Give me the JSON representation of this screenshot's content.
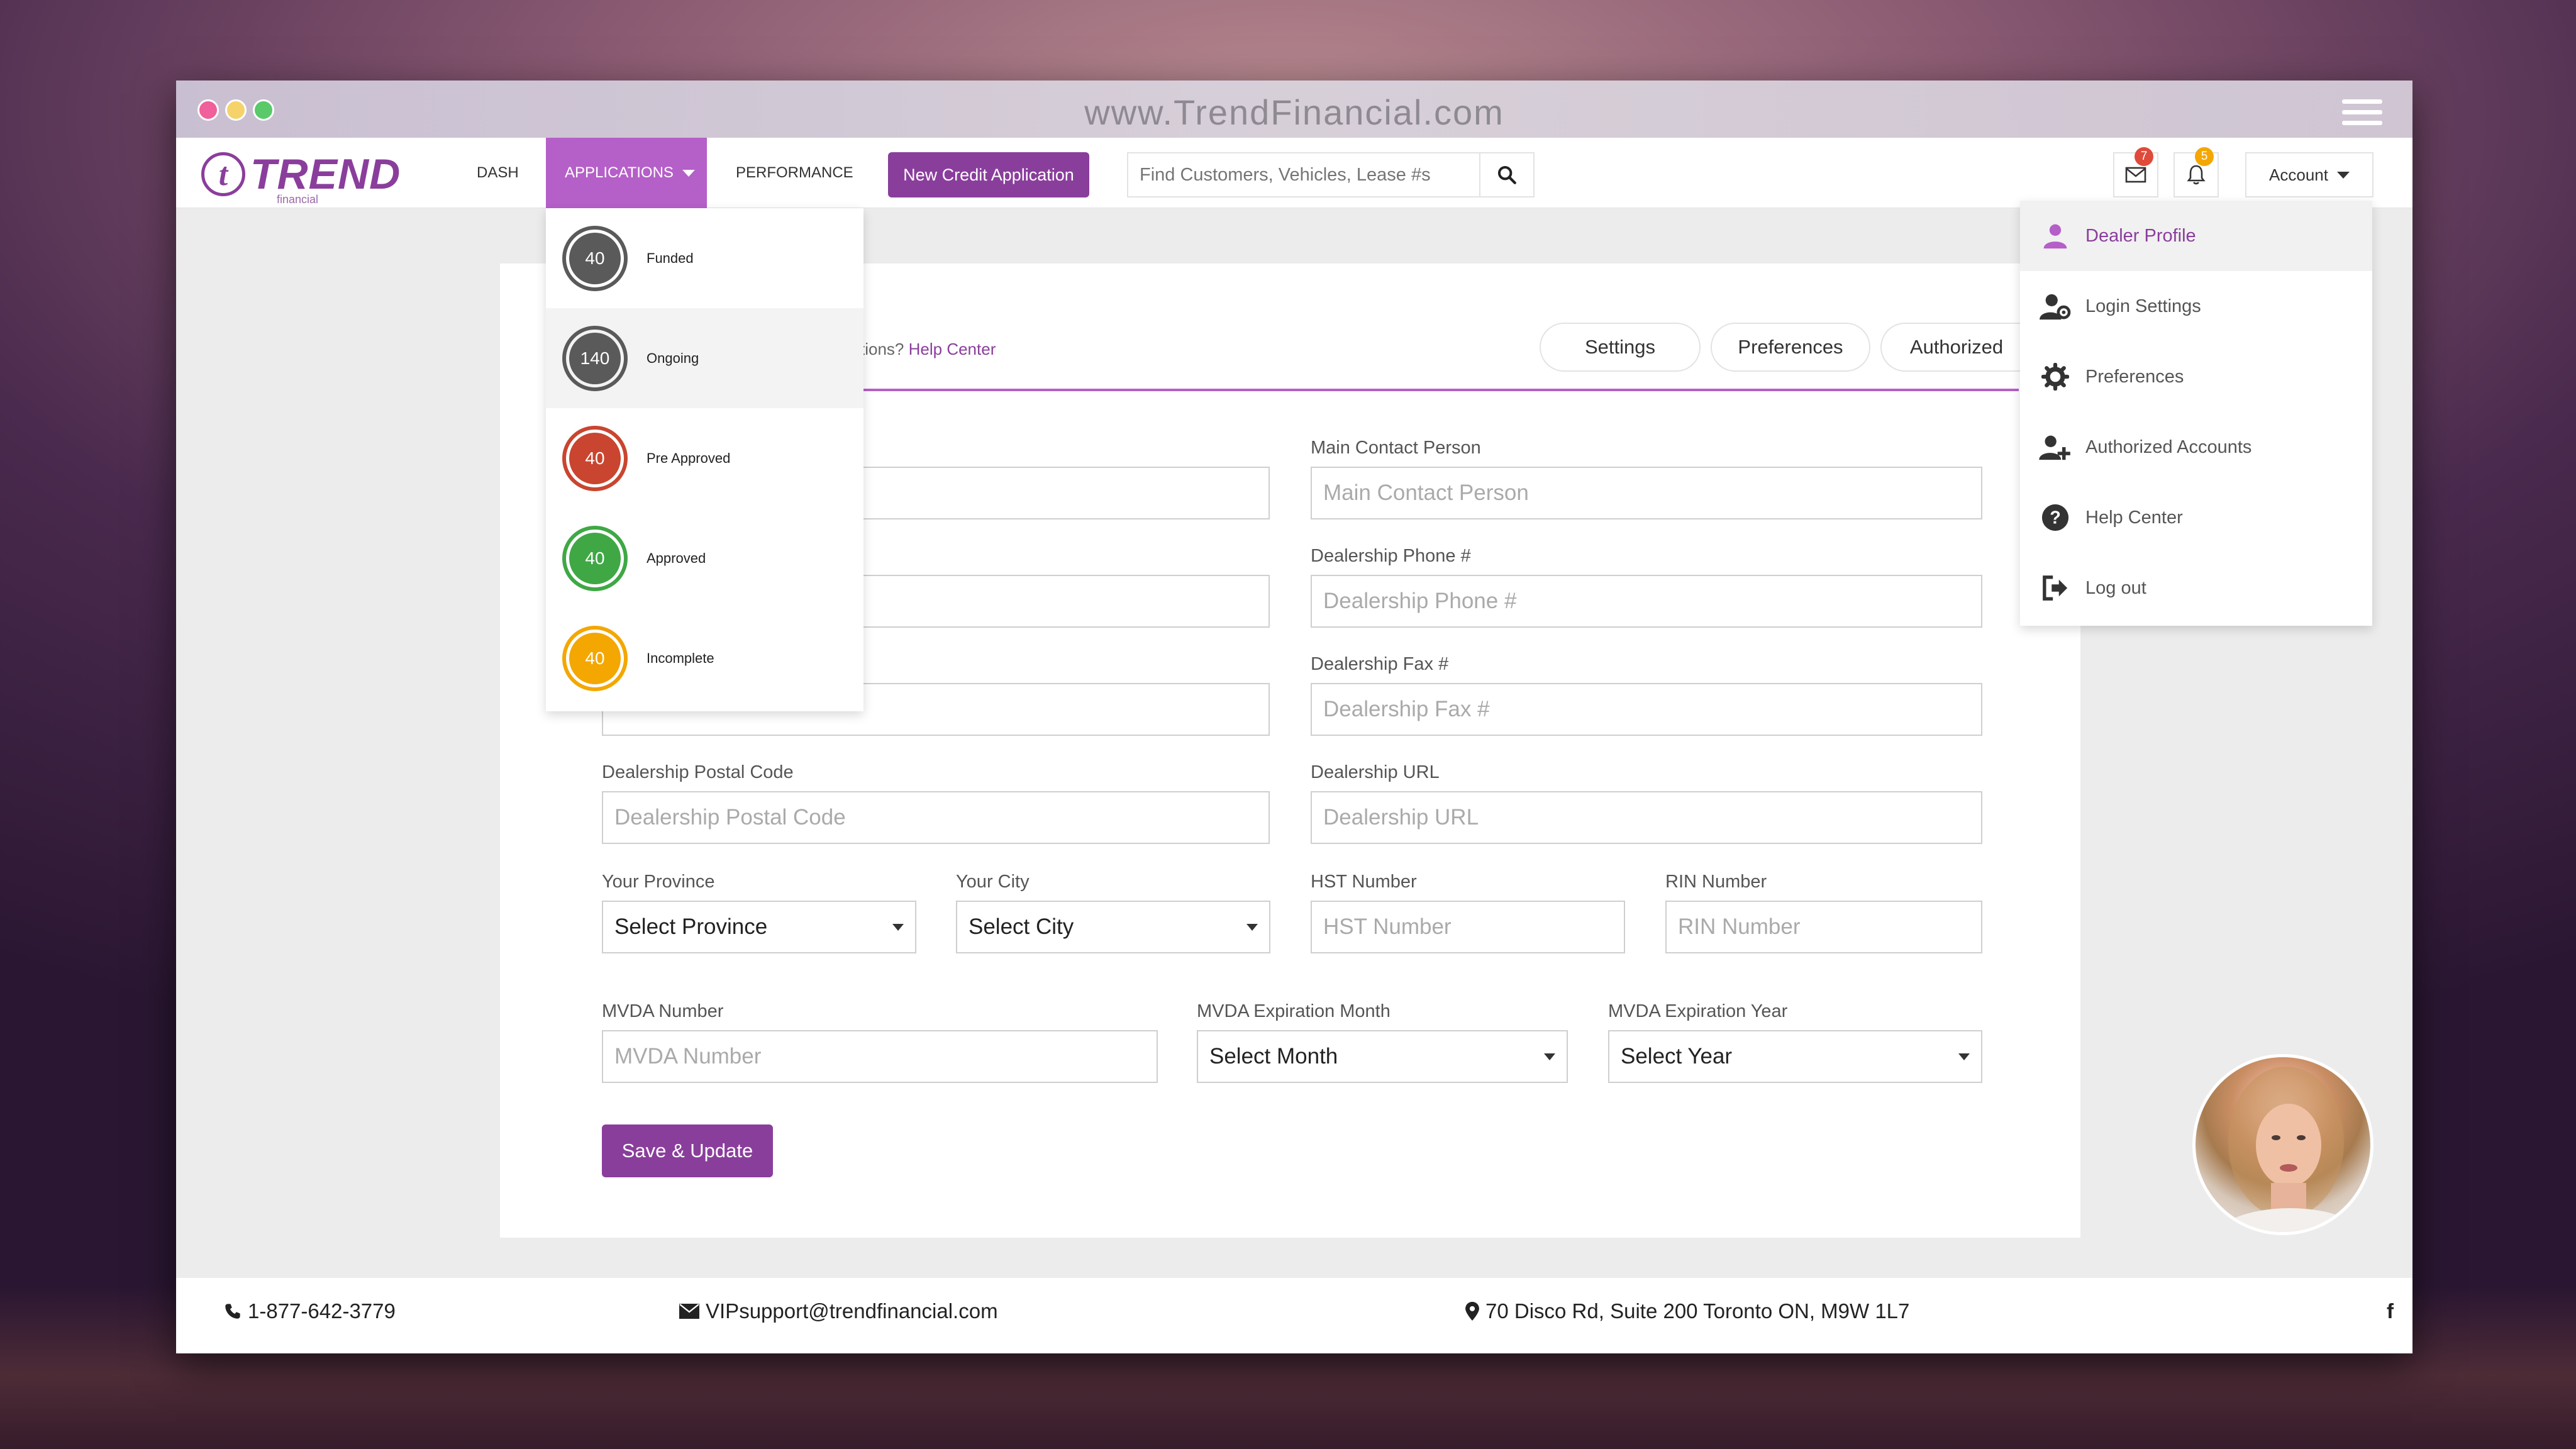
{
  "window": {
    "url": "www.TrendFinancial.com"
  },
  "brand": {
    "name": "TREND",
    "sub": "financial",
    "color": "#8a3e9c"
  },
  "nav": {
    "dash": "DASH",
    "applications": "APPLICATIONS",
    "performance": "PERFORMANCE",
    "new_credit": "New Credit Application",
    "search_placeholder": "Find Customers, Vehicles, Lease #s",
    "mail_count": "7",
    "notif_count": "5",
    "account": "Account"
  },
  "applications_menu": [
    {
      "count": "40",
      "label": "Funded",
      "color": "#5a5a5a"
    },
    {
      "count": "140",
      "label": "Ongoing",
      "color": "#5a5a5a"
    },
    {
      "count": "40",
      "label": "Pre Approved",
      "color": "#c9452f"
    },
    {
      "count": "40",
      "label": "Approved",
      "color": "#3fa845"
    },
    {
      "count": "40",
      "label": "Incomplete",
      "color": "#f3a700"
    }
  ],
  "account_menu": [
    {
      "label": "Dealer Profile",
      "icon": "user-icon"
    },
    {
      "label": "Login Settings",
      "icon": "user-settings-icon"
    },
    {
      "label": "Preferences",
      "icon": "gear-icon"
    },
    {
      "label": "Authorized Accounts",
      "icon": "user-add-icon"
    },
    {
      "label": "Help Center",
      "icon": "question-icon"
    },
    {
      "label": "Log out",
      "icon": "logout-icon"
    }
  ],
  "profile": {
    "help_prefix": "tions?",
    "help_link": "Help Center",
    "tabs": [
      "Settings",
      "Preferences",
      "Authorized"
    ],
    "fields": {
      "main_contact": {
        "label": "Main Contact Person",
        "placeholder": "Main Contact Person"
      },
      "phone": {
        "label": "Dealership Phone #",
        "placeholder": "Dealership Phone #"
      },
      "fax": {
        "label": "Dealership Fax #",
        "placeholder": "Dealership Fax #"
      },
      "postal": {
        "label": "Dealership Postal Code",
        "placeholder": "Dealership Postal Code"
      },
      "url": {
        "label": "Dealership URL",
        "placeholder": "Dealership URL"
      },
      "province": {
        "label": "Your Province",
        "value": "Select Province"
      },
      "city": {
        "label": "Your City",
        "value": "Select City"
      },
      "hst": {
        "label": "HST Number",
        "placeholder": "HST Number"
      },
      "rin": {
        "label": "RIN Number",
        "placeholder": "RIN Number"
      },
      "mvda": {
        "label": "MVDA Number",
        "placeholder": "MVDA Number"
      },
      "mvda_month": {
        "label": "MVDA Expiration Month",
        "value": "Select Month"
      },
      "mvda_year": {
        "label": "MVDA Expiration Year",
        "value": "Select Year"
      }
    },
    "save_label": "Save & Update"
  },
  "footer": {
    "phone": "1-877-642-3779",
    "email": "VIPsupport@trendfinancial.com",
    "address": "70 Disco Rd, Suite 200 Toronto ON, M9W 1L7",
    "social": "f"
  }
}
